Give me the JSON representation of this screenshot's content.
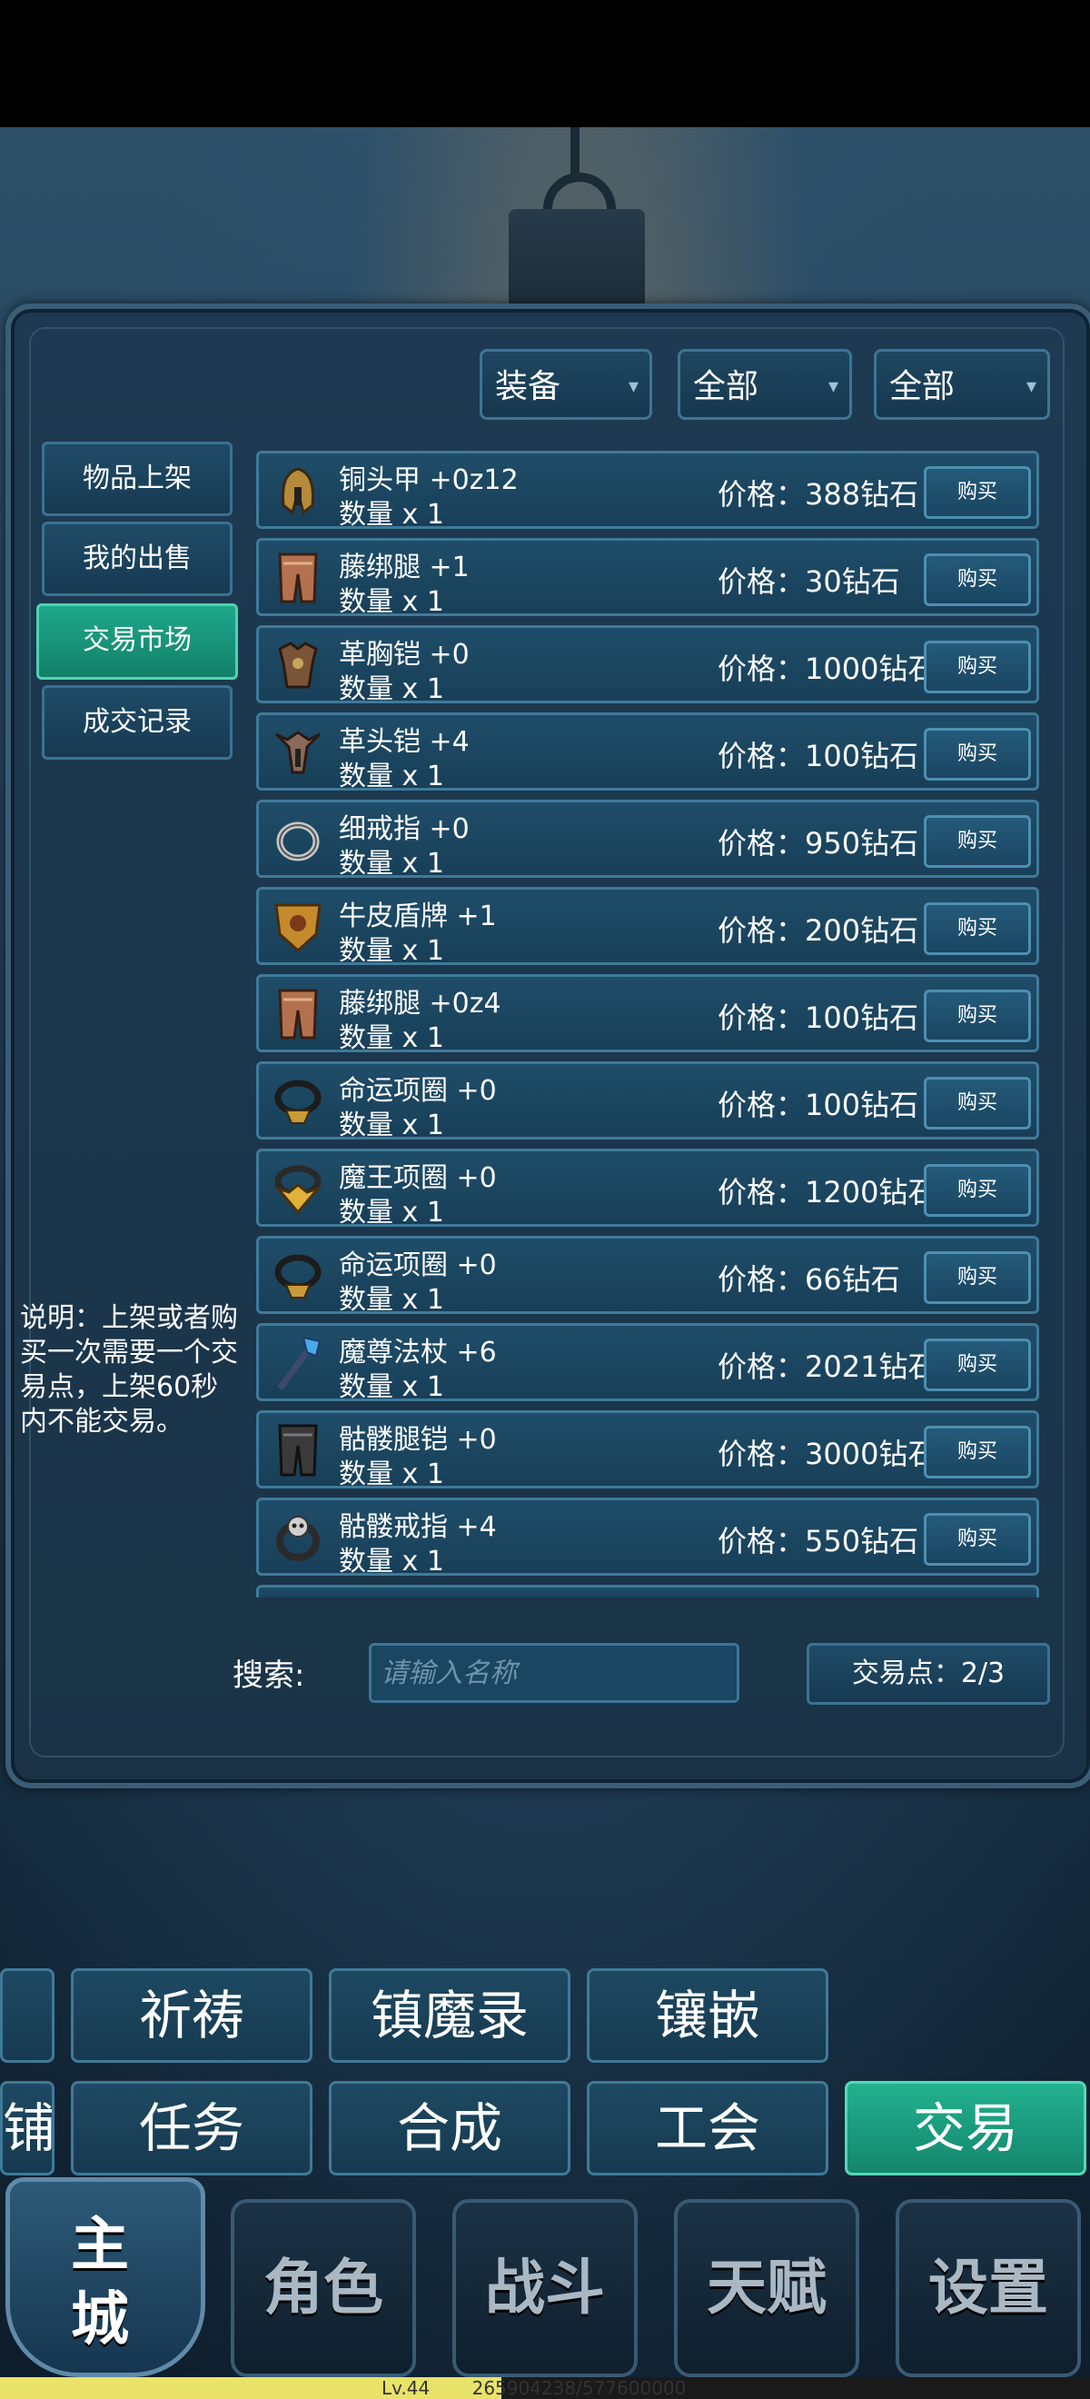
{
  "filters": [
    "装备",
    "全部",
    "全部"
  ],
  "sidebar": {
    "items": [
      {
        "label": "物品上架"
      },
      {
        "label": "我的出售"
      },
      {
        "label": "交易市场",
        "active": true
      },
      {
        "label": "成交记录"
      }
    ]
  },
  "listings": [
    {
      "name": "铜头甲 +0z12",
      "qty": "数量 x 1",
      "price": "价格：388钻石",
      "buy": "购买",
      "icon": "helmet-icon"
    },
    {
      "name": "藤绑腿 +1",
      "qty": "数量 x 1",
      "price": "价格：30钻石",
      "buy": "购买",
      "icon": "leggings-icon"
    },
    {
      "name": "革胸铠 +0",
      "qty": "数量 x 1",
      "price": "价格：1000钻石",
      "buy": "购买",
      "icon": "chest-armor-icon"
    },
    {
      "name": "革头铠 +4",
      "qty": "数量 x 1",
      "price": "价格：100钻石",
      "buy": "购买",
      "icon": "winged-helmet-icon"
    },
    {
      "name": "细戒指 +0",
      "qty": "数量 x 1",
      "price": "价格：950钻石",
      "buy": "购买",
      "icon": "ring-icon"
    },
    {
      "name": "牛皮盾牌 +1",
      "qty": "数量 x 1",
      "price": "价格：200钻石",
      "buy": "购买",
      "icon": "shield-icon"
    },
    {
      "name": "藤绑腿 +0z4",
      "qty": "数量 x 1",
      "price": "价格：100钻石",
      "buy": "购买",
      "icon": "leggings-icon"
    },
    {
      "name": "命运项圈 +0",
      "qty": "数量 x 1",
      "price": "价格：100钻石",
      "buy": "购买",
      "icon": "necklace-icon"
    },
    {
      "name": "魔王项圈 +0",
      "qty": "数量 x 1",
      "price": "价格：1200钻石",
      "buy": "购买",
      "icon": "gold-necklace-icon"
    },
    {
      "name": "命运项圈 +0",
      "qty": "数量 x 1",
      "price": "价格：66钻石",
      "buy": "购买",
      "icon": "necklace-icon"
    },
    {
      "name": "魔尊法杖 +6",
      "qty": "数量 x 1",
      "price": "价格：2021钻石",
      "buy": "购买",
      "icon": "staff-icon"
    },
    {
      "name": "骷髅腿铠 +0",
      "qty": "数量 x 1",
      "price": "价格：3000钻石",
      "buy": "购买",
      "icon": "dark-leggings-icon"
    },
    {
      "name": "骷髅戒指 +4",
      "qty": "数量 x 1",
      "price": "价格：550钻石",
      "buy": "购买",
      "icon": "skull-ring-icon"
    }
  ],
  "note": "说明：上架或者购买一次需要一个交易点，上架60秒内不能交易。",
  "search": {
    "label": "搜索:",
    "placeholder": "请输入名称"
  },
  "trade_points": "交易点：2/3",
  "menu_row1": [
    "祈祷",
    "镇魔录",
    "镶嵌"
  ],
  "menu_row2": [
    "铺",
    "任务",
    "合成",
    "工会",
    "交易"
  ],
  "bottom_nav": [
    "主城",
    "角色",
    "战斗",
    "天赋",
    "设置"
  ],
  "status": {
    "level": "Lv.44",
    "exp": "265904238/577600000",
    "exp_fraction": 0.46
  },
  "colors": {
    "accent": "#1fa88a",
    "panel": "#1d3a52",
    "xp": "#e9e36a"
  }
}
